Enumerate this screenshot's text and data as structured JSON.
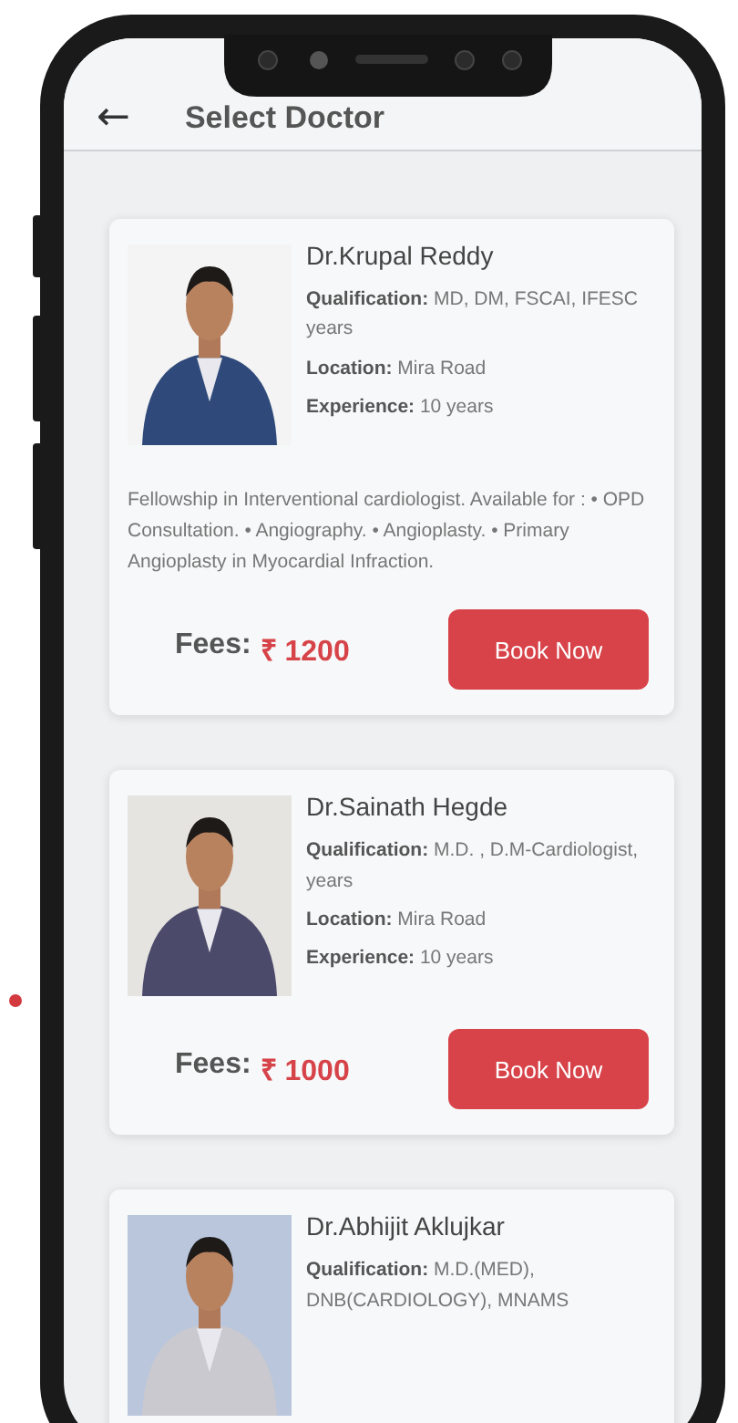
{
  "header": {
    "back": "←",
    "title": "Select Doctor"
  },
  "doctors": [
    {
      "name": "Dr.Krupal Reddy",
      "details": [
        "**Qualification:** MD, DM, FSCAI, IFESC years",
        "**Location:** Mira Road",
        "**Experience:** 10 years"
      ],
      "about": "Fellowship in Interventional cardiologist. Available for : • OPD Consultation. • Angiography. • Angioplasty. • Primary Angioplasty in Myocardial Infraction.",
      "fees_label": "Fees:",
      "fee": "₹ 1200",
      "button": "Book Now"
    },
    {
      "name": "Dr.Sainath Hegde",
      "details": [
        "**Qualification:** M.D. , D.M-Cardiologist, years",
        "**Location:** Mira Road",
        "**Experience:** 10 years"
      ],
      "fees_label": "Fees:",
      "fee": "₹ 1000",
      "button": "Book Now"
    },
    {
      "name": "Dr.Abhijit Aklujkar",
      "details": [
        "**Qualification:** M.D.(MED), DNB(CARDIOLOGY), MNAMS"
      ]
    }
  ]
}
